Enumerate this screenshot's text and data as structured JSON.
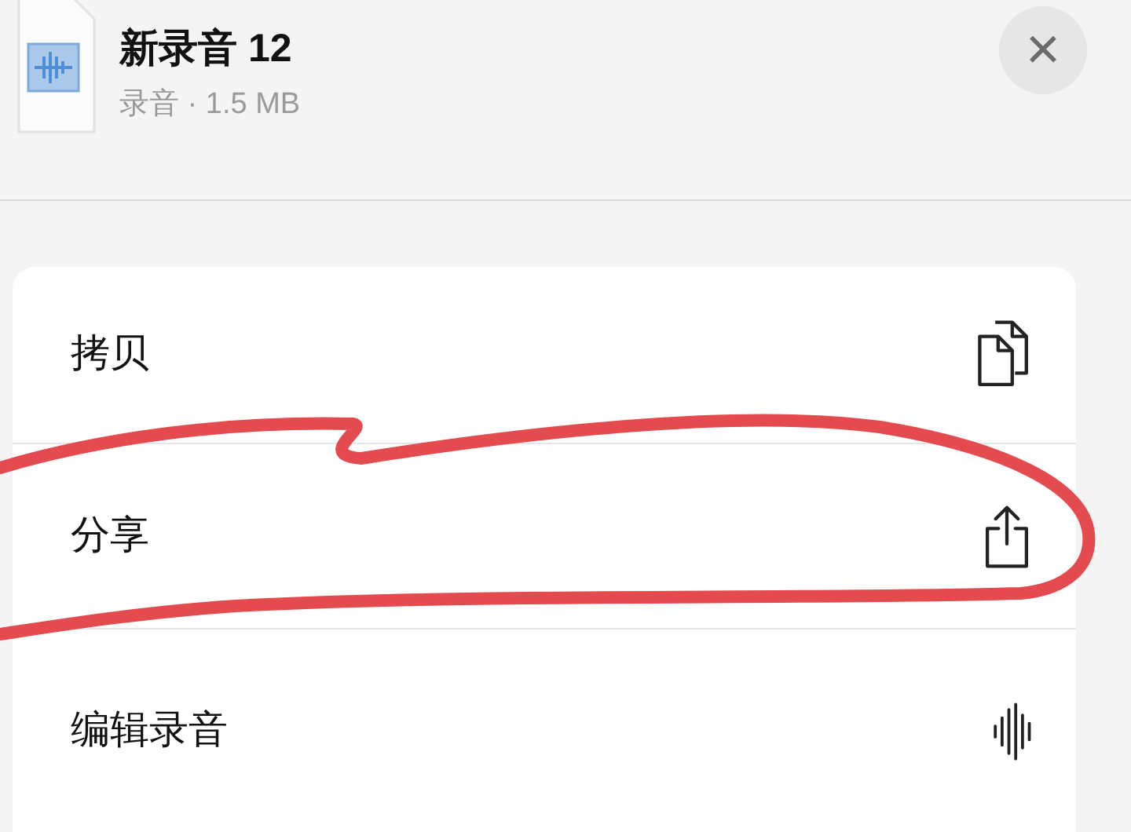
{
  "file": {
    "title": "新录音 12",
    "subtitle": "录音 · 1.5 MB"
  },
  "close_button": {
    "label": "×"
  },
  "actions": [
    {
      "label": "拷贝",
      "kind": "copy"
    },
    {
      "label": "分享",
      "kind": "share"
    },
    {
      "label": "编辑录音",
      "kind": "edit"
    }
  ]
}
